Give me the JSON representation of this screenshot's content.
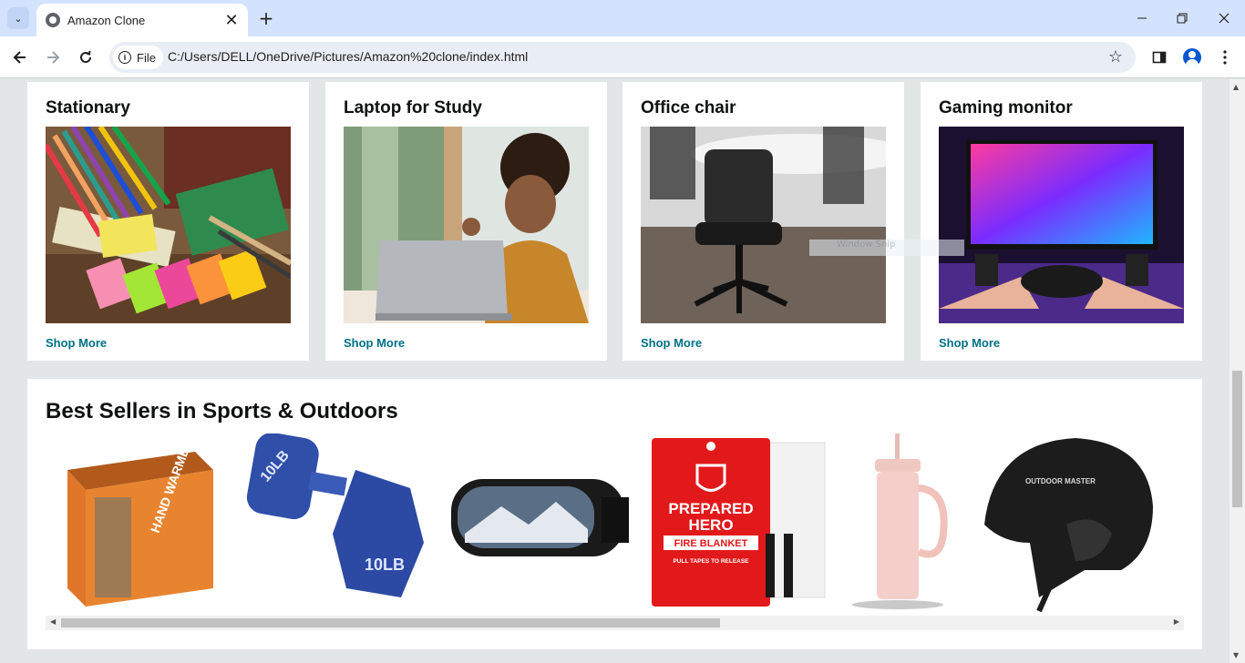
{
  "browser": {
    "tab_title": "Amazon Clone",
    "tab_close": "✕",
    "new_tab": "+",
    "chip_label": "File",
    "url": "C:/Users/DELL/OneDrive/Pictures/Amazon%20clone/index.html"
  },
  "cards": [
    {
      "title": "Stationary",
      "link": "Shop More"
    },
    {
      "title": "Laptop for Study",
      "link": "Shop More"
    },
    {
      "title": "Office chair",
      "link": "Shop More"
    },
    {
      "title": "Gaming monitor",
      "link": "Shop More"
    }
  ],
  "best_sellers": {
    "title": "Best Sellers in Sports & Outdoors",
    "product_text": {
      "hand_warmers": "HAND WARMERS",
      "dumbbell_weight": "10LB",
      "goggle_brand": "OUTDOOR MASTER",
      "blanket_line1": "PREPARED",
      "blanket_line2": "HERO",
      "blanket_line3": "FIRE BLANKET",
      "blanket_line4": "PULL TAPES TO RELEASE",
      "helmet_brand": "OUTDOOR MASTER"
    }
  },
  "overlay": {
    "tooltip": "Window Snip"
  },
  "colors": {
    "tabbar": "#d3e3fd",
    "page_bg": "#e3e6e6",
    "link": "#007185",
    "heading": "#0f1111"
  }
}
